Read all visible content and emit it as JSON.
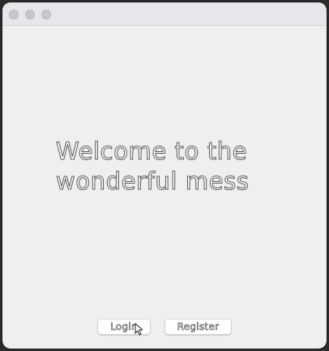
{
  "window": {
    "background": "#f0efef",
    "titlebar_color": "#e8e6ea"
  },
  "welcome": {
    "text": "Welcome to the\nwonderful mess"
  },
  "buttons": {
    "login_label": "Login",
    "register_label": "Register"
  },
  "icons": {
    "cursor": "arrow-cursor-icon"
  }
}
